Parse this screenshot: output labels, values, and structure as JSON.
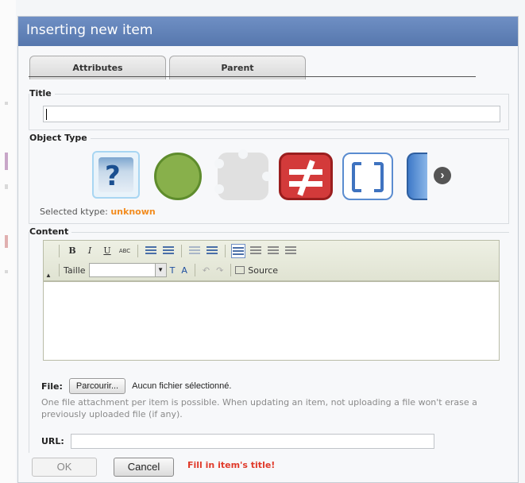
{
  "dialog": {
    "title": "Inserting new item"
  },
  "tabs": [
    {
      "label": "Attributes"
    },
    {
      "label": "Parent"
    }
  ],
  "sections": {
    "title": "Title",
    "object_type": "Object Type",
    "content": "Content"
  },
  "title_input": {
    "value": ""
  },
  "object_types": {
    "icons": [
      "question-icon",
      "circle-icon",
      "dots-icon",
      "not-equal-icon",
      "brackets-icon",
      "cylinder-icon"
    ],
    "next": "›",
    "selected_label": "Selected ktype:",
    "selected_value": "unknown"
  },
  "toolbar": {
    "bold": "B",
    "italic": "I",
    "underline": "U",
    "strike": "ABC",
    "font_size_label": "Taille",
    "text_color": "T",
    "bg_color": "A",
    "source": "Source",
    "undo": "↶",
    "redo": "↷"
  },
  "file": {
    "label": "File:",
    "browse": "Parcourir...",
    "status": "Aucun fichier sélectionné.",
    "hint": "One file attachment per item is possible. When updating an item, not uploading a file won't erase a previously uploaded file (if any)."
  },
  "url": {
    "label": "URL:",
    "value": ""
  },
  "buttons": {
    "ok": "OK",
    "cancel": "Cancel"
  },
  "error": "Fill in item's title!",
  "colors": {
    "titlebar": "#5f80b8",
    "accent_orange": "#f28c1f",
    "error_red": "#e03a2a"
  }
}
